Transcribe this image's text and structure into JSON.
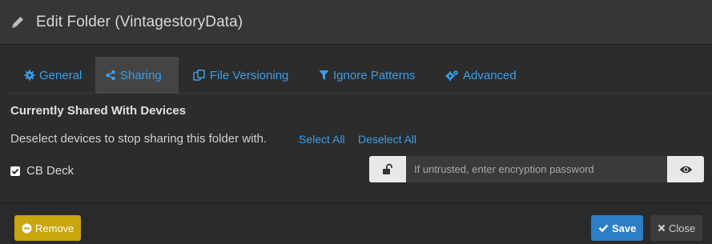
{
  "header": {
    "title": "Edit Folder (VintagestoryData)",
    "icon": "pencil-icon"
  },
  "tabs": [
    {
      "label": "General",
      "icon": "gear-icon",
      "active": false
    },
    {
      "label": "Sharing",
      "icon": "share-icon",
      "active": true
    },
    {
      "label": "File Versioning",
      "icon": "copy-icon",
      "active": false
    },
    {
      "label": "Ignore Patterns",
      "icon": "filter-icon",
      "active": false
    },
    {
      "label": "Advanced",
      "icon": "gears-icon",
      "active": false
    }
  ],
  "sharing": {
    "section_title": "Currently Shared With Devices",
    "hint": "Deselect devices to stop sharing this folder with.",
    "select_all": "Select All",
    "deselect_all": "Deselect All",
    "devices": [
      {
        "name": "CB Deck",
        "checked": true,
        "password_placeholder": "If untrusted, enter encryption password",
        "password_value": ""
      }
    ]
  },
  "footer": {
    "remove_label": "Remove",
    "save_label": "Save",
    "close_label": "Close"
  },
  "colors": {
    "accent": "#3a9ee8",
    "remove": "#c9a50e",
    "save": "#2c7fc4",
    "background": "#2c2c2c"
  }
}
